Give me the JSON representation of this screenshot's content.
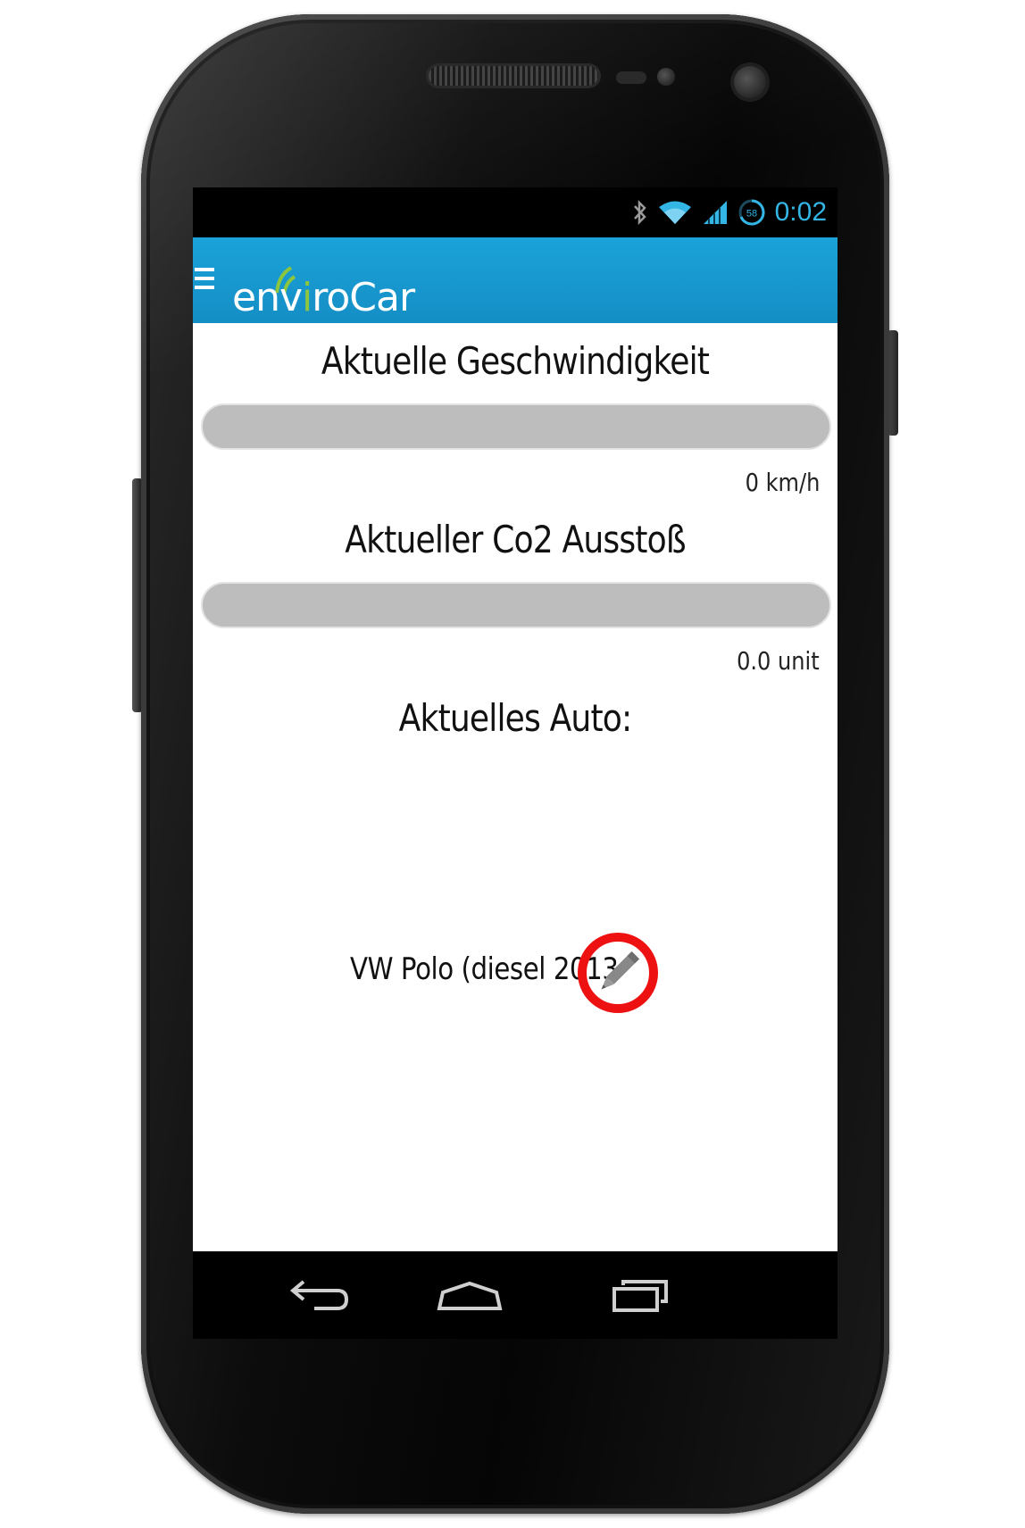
{
  "status_bar": {
    "time": "0:02",
    "battery_level": "58",
    "icons": [
      "bluetooth-icon",
      "wifi-icon",
      "signal-icon",
      "battery-icon"
    ],
    "time_color": "#33b5e5"
  },
  "app_bar": {
    "logo_text_before": "env",
    "logo_text_accent": "i",
    "logo_text_after": "roCar",
    "brand_color": "#1ba3d9",
    "accent_color": "#8cc63f",
    "menu_icon": "hamburger-menu-icon"
  },
  "main": {
    "speed": {
      "title": "Aktuelle Geschwindigkeit",
      "value_label": "0 km/h",
      "progress_fraction": 0
    },
    "co2": {
      "title": "Aktueller Co2 Ausstoß",
      "value_label": "0.0 unit",
      "progress_fraction": 0
    },
    "car": {
      "title": "Aktuelles Auto:",
      "name": "VW Polo (diesel 2013",
      "edit_icon": "pencil-icon",
      "highlight_color": "#ee1111"
    }
  },
  "nav_bar": {
    "buttons": [
      "back-icon",
      "home-icon",
      "recents-icon"
    ]
  }
}
